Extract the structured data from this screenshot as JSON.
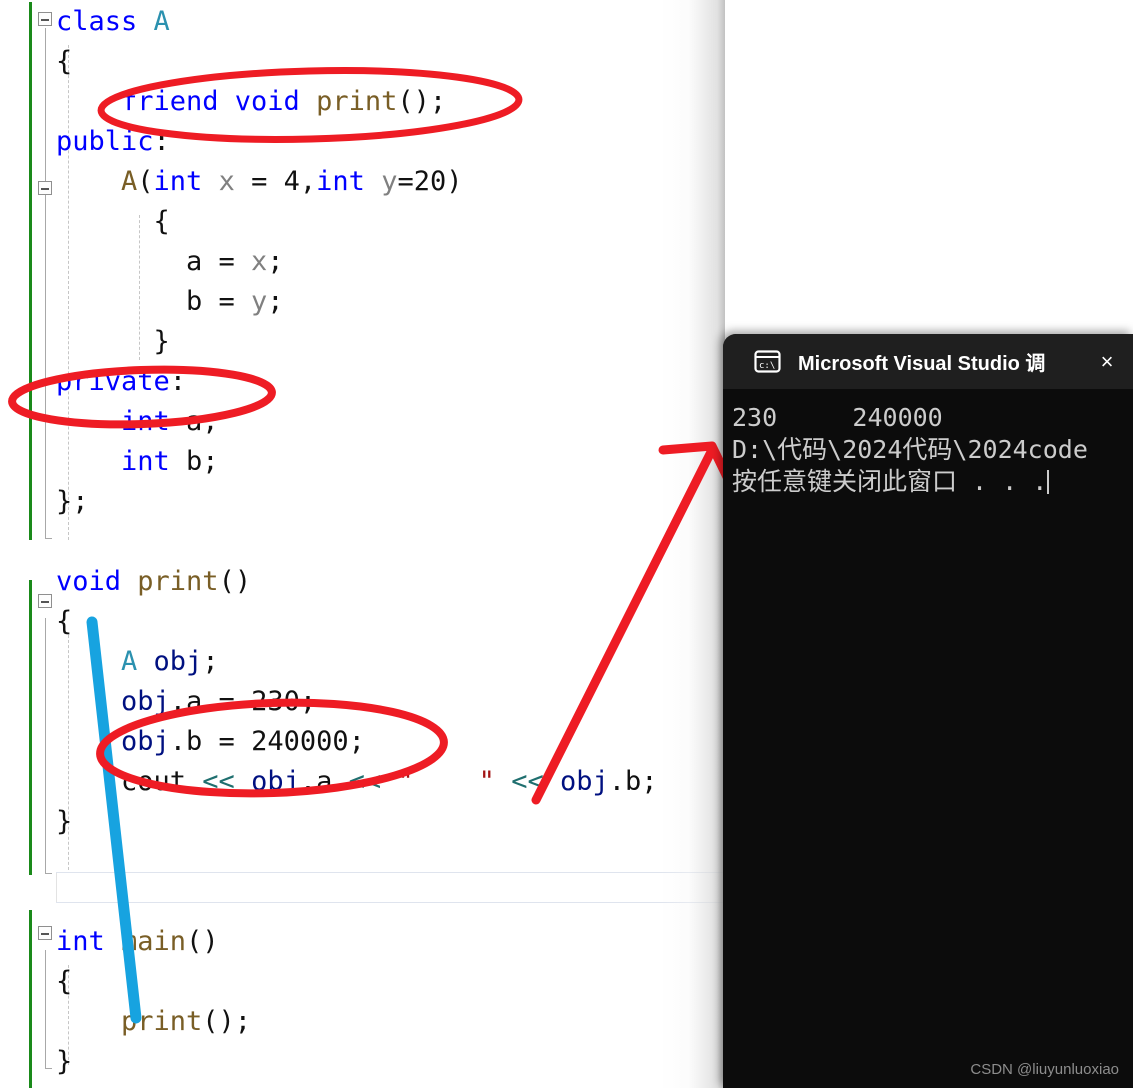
{
  "editor": {
    "name": "visual-studio-code-editor",
    "background": "#ffffff",
    "change_bar_color": "#1a8a1a",
    "lines": [
      {
        "indent": 0,
        "tokens": [
          {
            "t": "class ",
            "c": "kw"
          },
          {
            "t": "A",
            "c": "ty"
          }
        ]
      },
      {
        "indent": 0,
        "tokens": [
          {
            "t": "{",
            "c": "plain"
          }
        ]
      },
      {
        "indent": 2,
        "tokens": [
          {
            "t": "friend void ",
            "c": "kw"
          },
          {
            "t": "print",
            "c": "fn"
          },
          {
            "t": "();",
            "c": "plain"
          }
        ]
      },
      {
        "indent": 0,
        "tokens": [
          {
            "t": "public",
            "c": "kw"
          },
          {
            "t": ":",
            "c": "plain"
          }
        ]
      },
      {
        "indent": 2,
        "tokens": [
          {
            "t": "A",
            "c": "fn"
          },
          {
            "t": "(",
            "c": "plain"
          },
          {
            "t": "int",
            "c": "kw"
          },
          {
            "t": " ",
            "c": "plain"
          },
          {
            "t": "x",
            "c": "pm"
          },
          {
            "t": " = ",
            "c": "plain"
          },
          {
            "t": "4",
            "c": "num"
          },
          {
            "t": ",",
            "c": "plain"
          },
          {
            "t": "int",
            "c": "kw"
          },
          {
            "t": " ",
            "c": "plain"
          },
          {
            "t": "y",
            "c": "pm"
          },
          {
            "t": "=20)",
            "c": "plain"
          }
        ]
      },
      {
        "indent": 3,
        "tokens": [
          {
            "t": "{",
            "c": "plain"
          }
        ]
      },
      {
        "indent": 4,
        "tokens": [
          {
            "t": "a = ",
            "c": "plain"
          },
          {
            "t": "x",
            "c": "pm"
          },
          {
            "t": ";",
            "c": "plain"
          }
        ]
      },
      {
        "indent": 4,
        "tokens": [
          {
            "t": "b = ",
            "c": "plain"
          },
          {
            "t": "y",
            "c": "pm"
          },
          {
            "t": ";",
            "c": "plain"
          }
        ]
      },
      {
        "indent": 3,
        "tokens": [
          {
            "t": "}",
            "c": "plain"
          }
        ]
      },
      {
        "indent": 0,
        "tokens": [
          {
            "t": "private",
            "c": "kw"
          },
          {
            "t": ":",
            "c": "plain"
          }
        ]
      },
      {
        "indent": 2,
        "tokens": [
          {
            "t": "int",
            "c": "kw"
          },
          {
            "t": " a;",
            "c": "plain"
          }
        ]
      },
      {
        "indent": 2,
        "tokens": [
          {
            "t": "int",
            "c": "kw"
          },
          {
            "t": " b;",
            "c": "plain"
          }
        ]
      },
      {
        "indent": 0,
        "tokens": [
          {
            "t": "};",
            "c": "plain"
          }
        ]
      },
      {
        "indent": 0,
        "tokens": []
      },
      {
        "indent": 0,
        "tokens": [
          {
            "t": "void ",
            "c": "kw"
          },
          {
            "t": "print",
            "c": "fn"
          },
          {
            "t": "()",
            "c": "plain"
          }
        ]
      },
      {
        "indent": 0,
        "tokens": [
          {
            "t": "{",
            "c": "plain"
          }
        ]
      },
      {
        "indent": 2,
        "tokens": [
          {
            "t": "A",
            "c": "ty"
          },
          {
            "t": " ",
            "c": "plain"
          },
          {
            "t": "obj",
            "c": "var"
          },
          {
            "t": ";",
            "c": "plain"
          }
        ]
      },
      {
        "indent": 2,
        "tokens": [
          {
            "t": "obj",
            "c": "var"
          },
          {
            "t": ".a = ",
            "c": "plain"
          },
          {
            "t": "230",
            "c": "num"
          },
          {
            "t": ";",
            "c": "plain"
          }
        ]
      },
      {
        "indent": 2,
        "tokens": [
          {
            "t": "obj",
            "c": "var"
          },
          {
            "t": ".b = ",
            "c": "plain"
          },
          {
            "t": "240000",
            "c": "num"
          },
          {
            "t": ";",
            "c": "plain"
          }
        ]
      },
      {
        "indent": 2,
        "tokens": [
          {
            "t": "cout ",
            "c": "plain"
          },
          {
            "t": "<<",
            "c": "op"
          },
          {
            "t": " ",
            "c": "plain"
          },
          {
            "t": "obj",
            "c": "var"
          },
          {
            "t": ".a ",
            "c": "plain"
          },
          {
            "t": "<<",
            "c": "op"
          },
          {
            "t": " ",
            "c": "plain"
          },
          {
            "t": "\"    \"",
            "c": "str"
          },
          {
            "t": " ",
            "c": "plain"
          },
          {
            "t": "<<",
            "c": "op"
          },
          {
            "t": " ",
            "c": "plain"
          },
          {
            "t": "obj",
            "c": "var"
          },
          {
            "t": ".b;",
            "c": "plain"
          }
        ]
      },
      {
        "indent": 0,
        "tokens": [
          {
            "t": "}",
            "c": "plain"
          }
        ]
      },
      {
        "indent": 0,
        "tokens": []
      },
      {
        "indent": 0,
        "tokens": []
      },
      {
        "indent": 0,
        "tokens": [
          {
            "t": "int ",
            "c": "kw"
          },
          {
            "t": "main",
            "c": "fn"
          },
          {
            "t": "()",
            "c": "plain"
          }
        ]
      },
      {
        "indent": 0,
        "tokens": [
          {
            "t": "{",
            "c": "plain"
          }
        ]
      },
      {
        "indent": 2,
        "tokens": [
          {
            "t": "print",
            "c": "fn"
          },
          {
            "t": "();",
            "c": "plain"
          }
        ]
      },
      {
        "indent": 0,
        "tokens": [
          {
            "t": "}",
            "c": "plain"
          }
        ]
      }
    ]
  },
  "annotations": {
    "ellipse_color": "#ee1c24",
    "arrow_color": "#ee1c24",
    "line_color": "#17a3e0",
    "items": [
      {
        "kind": "ellipse",
        "name": "highlight-friend-declaration",
        "target": "friend void print();"
      },
      {
        "kind": "ellipse",
        "name": "highlight-private-keyword",
        "target": "private:"
      },
      {
        "kind": "ellipse",
        "name": "highlight-obj-assignments",
        "target": "obj.a = 230; obj.b = 240000;"
      },
      {
        "kind": "arrow",
        "name": "arrow-to-console-output",
        "target": "console output"
      },
      {
        "kind": "line",
        "name": "blue-underline-stroke",
        "target": "print function body"
      }
    ]
  },
  "console": {
    "name": "debug-console-window",
    "icon": "cmd-prompt-icon",
    "title": "Microsoft Visual Studio 调试控",
    "close_label": "×",
    "title_background": "#1f1f1f",
    "body_background": "#0c0c0c",
    "text_color": "#cccccc",
    "lines": [
      "230     240000",
      "D:\\代码\\2024代码\\2024code",
      "按任意键关闭此窗口 . . ."
    ],
    "watermark": "CSDN @liuyunluoxiao"
  }
}
